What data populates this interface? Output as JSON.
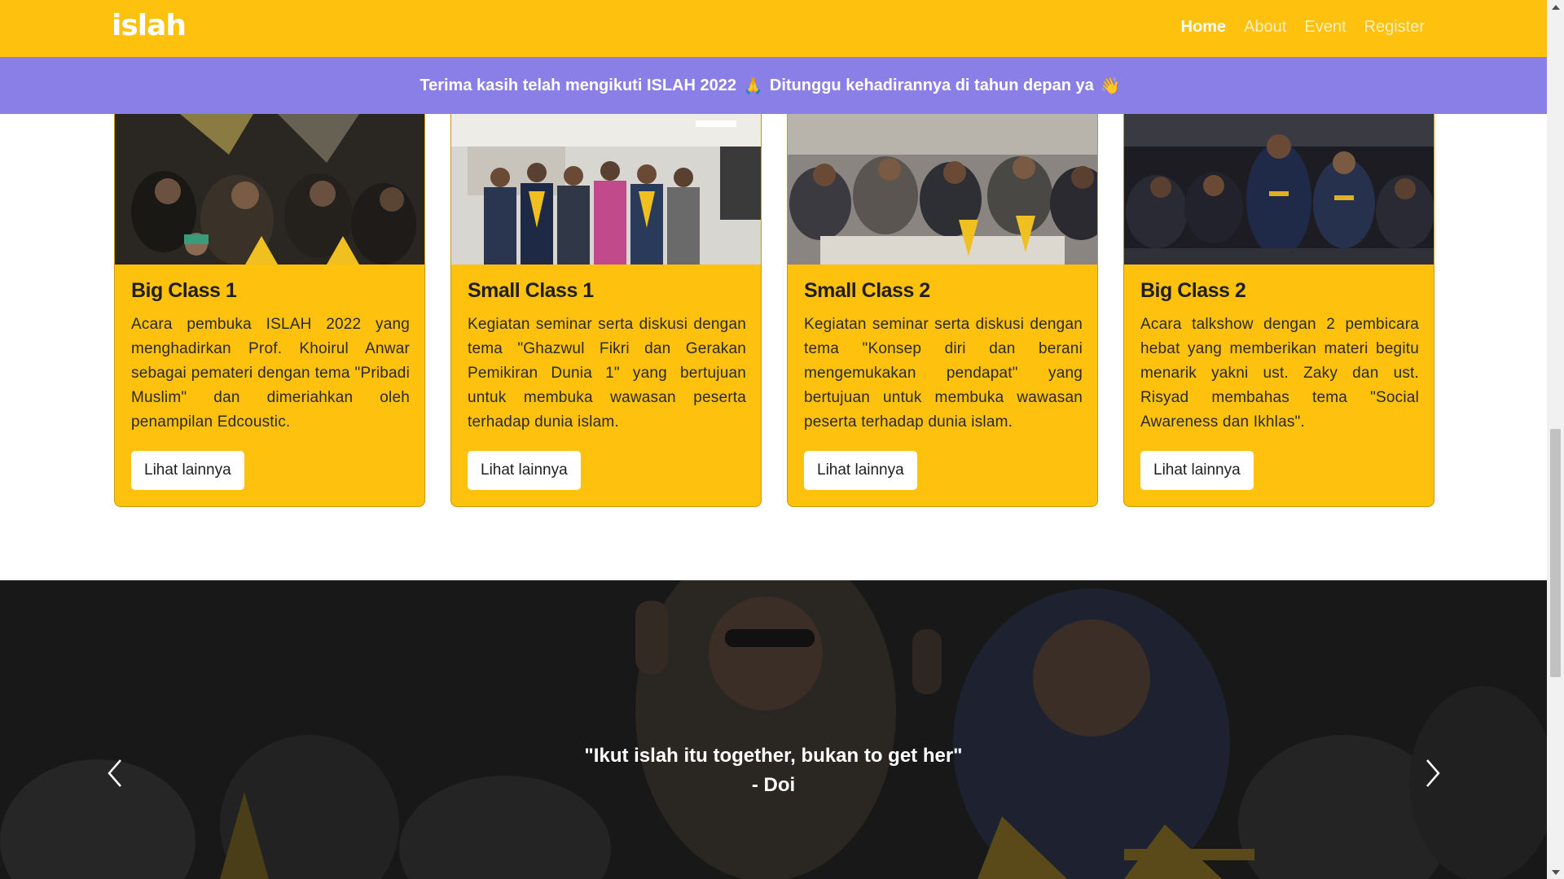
{
  "navbar": {
    "logo": "islah",
    "links": [
      {
        "label": "Home",
        "active": true
      },
      {
        "label": "About",
        "active": false
      },
      {
        "label": "Event",
        "active": false
      },
      {
        "label": "Register",
        "active": false
      }
    ]
  },
  "banner": {
    "text_part1": "Terima kasih telah mengikuti ISLAH 2022",
    "emoji1": "🙏",
    "text_part2": "Ditunggu kehadirannya di tahun depan ya",
    "emoji2": "👋"
  },
  "cards": [
    {
      "title": "Big Class 1",
      "text": "Acara pembuka ISLAH 2022 yang menghadirkan Prof. Khoirul Anwar sebagai pemateri dengan tema \"Pribadi Muslim\" dan dimeriahkan oleh penampilan Edcoustic.",
      "button": "Lihat lainnya"
    },
    {
      "title": "Small Class 1",
      "text": "Kegiatan seminar serta diskusi dengan tema \"Ghazwul Fikri dan Gerakan Pemikiran Dunia 1\" yang bertujuan untuk membuka wawasan peserta terhadap dunia islam.",
      "button": "Lihat lainnya"
    },
    {
      "title": "Small Class 2",
      "text": "Kegiatan seminar serta diskusi dengan tema \"Konsep diri dan berani mengemukakan pendapat\" yang bertujuan untuk membuka wawasan peserta terhadap dunia islam.",
      "button": "Lihat lainnya"
    },
    {
      "title": "Big Class 2",
      "text": "Acara talkshow dengan 2 pembicara hebat yang memberikan materi begitu menarik yakni ust. Zaky dan ust. Risyad membahas tema \"Social Awareness dan Ikhlas\".",
      "button": "Lihat lainnya"
    }
  ],
  "testimonial": {
    "quote": "\"Ikut islah itu together, bukan to get her\"",
    "author": "- Doi"
  },
  "colors": {
    "primary_yellow": "#FDC10E",
    "banner_purple": "#8A7FE6",
    "carousel_dark": "#141414"
  },
  "icons": {
    "prev": "chevron-left-icon",
    "next": "chevron-right-icon"
  }
}
